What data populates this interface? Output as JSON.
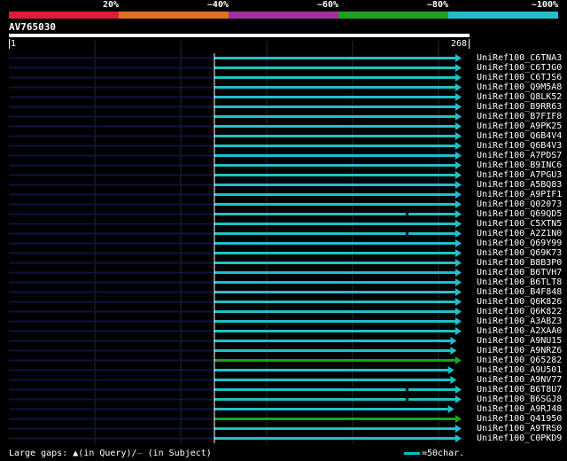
{
  "scale": {
    "labels": [
      "20%",
      "~40%",
      "~60%",
      "~80%",
      "~100%"
    ],
    "colors": [
      "#e01c3c",
      "#e07020",
      "#a030a0",
      "#20a020",
      "#20c0c8"
    ]
  },
  "query": {
    "id": "AV765030",
    "start": "1",
    "end": "268"
  },
  "colors": {
    "hit": "#20c0c8",
    "hit_green": "#20a020",
    "dim": "#0c1440",
    "grid": "#2a2a2a"
  },
  "hits": [
    {
      "label": "UniRef100_C6TNA3",
      "color": "cyan",
      "end_frac": 1.0
    },
    {
      "label": "UniRef100_C6TJG0",
      "color": "cyan",
      "end_frac": 1.0
    },
    {
      "label": "UniRef100_C6TJS6",
      "color": "cyan",
      "end_frac": 1.0
    },
    {
      "label": "UniRef100_Q9M5A8",
      "color": "cyan",
      "end_frac": 1.0
    },
    {
      "label": "UniRef100_Q8LK52",
      "color": "cyan",
      "end_frac": 1.0
    },
    {
      "label": "UniRef100_B9RR63",
      "color": "cyan",
      "end_frac": 1.0
    },
    {
      "label": "UniRef100_B7FIF8",
      "color": "cyan",
      "end_frac": 1.0
    },
    {
      "label": "UniRef100_A9PK25",
      "color": "cyan",
      "end_frac": 1.0
    },
    {
      "label": "UniRef100_Q6B4V4",
      "color": "cyan",
      "end_frac": 1.0
    },
    {
      "label": "UniRef100_Q6B4V3",
      "color": "cyan",
      "end_frac": 1.0
    },
    {
      "label": "UniRef100_A7PDS7",
      "color": "cyan",
      "end_frac": 1.0
    },
    {
      "label": "UniRef100_B9INC6",
      "color": "cyan",
      "end_frac": 1.0
    },
    {
      "label": "UniRef100_A7PGU3",
      "color": "cyan",
      "end_frac": 1.0
    },
    {
      "label": "UniRef100_A5BQ83",
      "color": "cyan",
      "end_frac": 1.0
    },
    {
      "label": "UniRef100_A9PIF1",
      "color": "cyan",
      "end_frac": 1.0
    },
    {
      "label": "UniRef100_Q02073",
      "color": "cyan",
      "end_frac": 1.0
    },
    {
      "label": "UniRef100_Q69QD5",
      "color": "cyan",
      "end_frac": 1.0,
      "mark": true
    },
    {
      "label": "UniRef100_C5XTN5",
      "color": "cyan",
      "end_frac": 1.0
    },
    {
      "label": "UniRef100_A2Z1N0",
      "color": "cyan",
      "end_frac": 1.0,
      "mark": true
    },
    {
      "label": "UniRef100_Q69Y99",
      "color": "cyan",
      "end_frac": 1.0
    },
    {
      "label": "UniRef100_Q69K73",
      "color": "cyan",
      "end_frac": 1.0
    },
    {
      "label": "UniRef100_B8B3P0",
      "color": "cyan",
      "end_frac": 1.0
    },
    {
      "label": "UniRef100_B6TVH7",
      "color": "cyan",
      "end_frac": 1.0
    },
    {
      "label": "UniRef100_B6TLT8",
      "color": "cyan",
      "end_frac": 1.0
    },
    {
      "label": "UniRef100_B4F848",
      "color": "cyan",
      "end_frac": 1.0
    },
    {
      "label": "UniRef100_Q6K826",
      "color": "cyan",
      "end_frac": 1.0
    },
    {
      "label": "UniRef100_Q6K822",
      "color": "cyan",
      "end_frac": 1.0
    },
    {
      "label": "UniRef100_A3ABZ3",
      "color": "cyan",
      "end_frac": 1.0
    },
    {
      "label": "UniRef100_A2XAA0",
      "color": "cyan",
      "end_frac": 1.0
    },
    {
      "label": "UniRef100_A9NU15",
      "color": "cyan",
      "end_frac": 0.98
    },
    {
      "label": "UniRef100_A9NRZ6",
      "color": "cyan",
      "end_frac": 0.98
    },
    {
      "label": "UniRef100_Q65282",
      "color": "green",
      "end_frac": 1.0
    },
    {
      "label": "UniRef100_A9U501",
      "color": "cyan",
      "end_frac": 0.97
    },
    {
      "label": "UniRef100_A9NV77",
      "color": "cyan",
      "end_frac": 0.98
    },
    {
      "label": "UniRef100_B6T8U7",
      "color": "cyan",
      "end_frac": 1.0,
      "mark": true
    },
    {
      "label": "UniRef100_B6SGJ8",
      "color": "cyan",
      "end_frac": 1.0,
      "mark": true
    },
    {
      "label": "UniRef100_A9RJ48",
      "color": "cyan",
      "end_frac": 0.97
    },
    {
      "label": "UniRef100_Q41950",
      "color": "green",
      "end_frac": 1.0
    },
    {
      "label": "UniRef100_A9TRS0",
      "color": "cyan",
      "end_frac": 1.0
    },
    {
      "label": "UniRef100_C0PKD9",
      "color": "cyan",
      "end_frac": 1.0
    }
  ],
  "legend": {
    "prefix": "Large gaps: ",
    "query_symbol": "▲",
    "query_text": "(in Query)/",
    "subject_symbol": "–",
    "subject_text": " (in Subject)",
    "scale_text": "=50char."
  }
}
